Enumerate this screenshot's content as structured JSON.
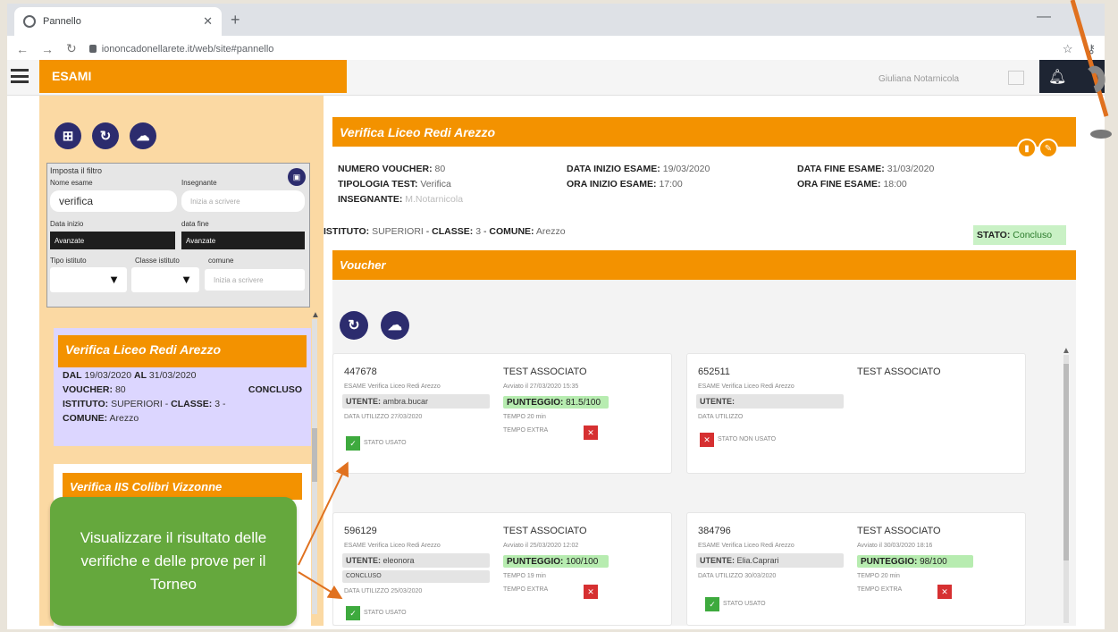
{
  "browser": {
    "tab_title": "Pannello",
    "url": "iononcadonellarete.it/web/site#pannello"
  },
  "app": {
    "section_title": "ESAMI",
    "username": "Giuliana Notarnicola"
  },
  "filter": {
    "title": "Imposta il filtro",
    "nome_label": "Nome esame",
    "nome_value": "verifica",
    "insegnante_label": "Insegnante",
    "insegnante_placeholder": "Inizia a scrivere",
    "data_inizio_label": "Data inizio",
    "data_inizio_value": "Avanzate",
    "data_fine_label": "data fine",
    "data_fine_value": "Avanzate",
    "tipo_label": "Tipo istituto",
    "classe_label": "Classe istituto",
    "comune_label": "comune",
    "comune_placeholder": "Inizia a scrivere"
  },
  "exam_card": {
    "title": "Verifica Liceo Redi Arezzo",
    "dal_label": "DAL",
    "dal_value": "19/03/2020",
    "al_label": "AL",
    "al_value": "31/03/2020",
    "voucher_label": "VOUCHER:",
    "voucher_value": "80",
    "status": "CONCLUSO",
    "istituto_label": "ISTITUTO:",
    "istituto_value": "SUPERIORI",
    "classe_label": "CLASSE:",
    "classe_value": "3",
    "comune_label": "COMUNE:",
    "comune_value": "Arezzo"
  },
  "exam_card2": {
    "title": "Verifica IIS Colibri Vizzonne"
  },
  "callout": {
    "text": "Visualizzare il risultato delle verifiche e delle prove per il Torneo"
  },
  "detail": {
    "title": "Verifica Liceo Redi Arezzo",
    "numero_voucher_label": "NUMERO VOUCHER:",
    "numero_voucher_value": "80",
    "tipologia_label": "TIPOLOGIA TEST:",
    "tipologia_value": "Verifica",
    "insegnante_label": "INSEGNANTE:",
    "insegnante_value": "M.Notarnicola",
    "data_inizio_label": "DATA INIZIO ESAME:",
    "data_inizio_value": "19/03/2020",
    "ora_inizio_label": "ORA INIZIO ESAME:",
    "ora_inizio_value": "17:00",
    "data_fine_label": "DATA FINE ESAME:",
    "data_fine_value": "31/03/2020",
    "ora_fine_label": "ORA FINE ESAME:",
    "ora_fine_value": "18:00",
    "istituto_label": "ISTITUTO:",
    "istituto_value": "SUPERIORI",
    "classe_label": "CLASSE:",
    "classe_value": "3",
    "comune_label": "COMUNE:",
    "comune_value": "Arezzo",
    "stato_label": "STATO:",
    "stato_value": "Concluso",
    "voucher_section": "Voucher"
  },
  "vouchers": [
    {
      "code": "447678",
      "test_label": "TEST ASSOCIATO",
      "esame": "ESAME  Verifica Liceo Redi Arezzo",
      "avviato": "Avviato il 27/03/2020 15:35",
      "utente_label": "UTENTE:",
      "utente_value": "ambra.bucar",
      "punteggio_label": "PUNTEGGIO:",
      "punteggio_value": "81.5/100",
      "data_utilizzo": "DATA UTILIZZO  27/03/2020",
      "tempo": "TEMPO  20 min",
      "tempo_extra": "TEMPO EXTRA",
      "stato": "STATO  USATO"
    },
    {
      "code": "652511",
      "test_label": "TEST ASSOCIATO",
      "esame": "ESAME  Verifica Liceo Redi Arezzo",
      "utente_label": "UTENTE:",
      "data_utilizzo": "DATA UTILIZZO",
      "stato": "STATO  NON USATO"
    },
    {
      "code": "596129",
      "test_label": "TEST ASSOCIATO",
      "esame": "ESAME  Verifica Liceo Redi Arezzo",
      "avviato": "Avviato il 25/03/2020 12:02",
      "utente_label": "UTENTE:",
      "utente_value": "eleonora",
      "punteggio_label": "PUNTEGGIO:",
      "punteggio_value": "100/100",
      "concluso": "CONCLUSO",
      "data_utilizzo": "DATA UTILIZZO  25/03/2020",
      "tempo": "TEMPO  19 min",
      "tempo_extra": "TEMPO EXTRA",
      "stato": "STATO  USATO"
    },
    {
      "code": "384796",
      "test_label": "TEST ASSOCIATO",
      "esame": "ESAME  Verifica Liceo Redi Arezzo",
      "avviato": "Avviato il 30/03/2020 18:16",
      "utente_label": "UTENTE:",
      "utente_value": "Elia.Caprari",
      "punteggio_label": "PUNTEGGIO:",
      "punteggio_value": "98/100",
      "data_utilizzo": "DATA UTILIZZO  30/03/2020",
      "tempo": "TEMPO  20 min",
      "tempo_extra": "TEMPO EXTRA",
      "stato": "STATO  USATO"
    }
  ],
  "colors": {
    "accent": "#f39200",
    "navy": "#2c2c6e",
    "success": "#3eaa3e",
    "danger": "#d63031",
    "callout": "#65a83d"
  }
}
